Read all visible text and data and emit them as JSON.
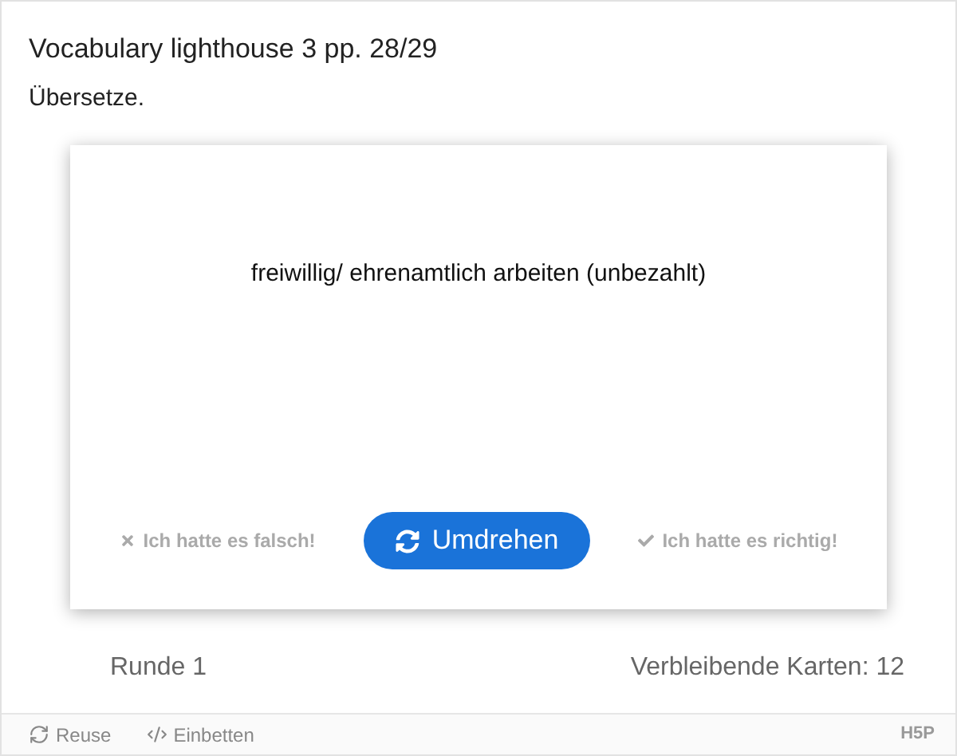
{
  "title": "Vocabulary lighthouse 3 pp. 28/29",
  "instruction": "Übersetze.",
  "card": {
    "text": "freiwillig/ ehrenamtlich arbeiten (unbezahlt)"
  },
  "actions": [
    {
      "kind": "wrong",
      "label": "Ich hatte es falsch!",
      "disabled": true
    },
    {
      "kind": "flip",
      "label": "Umdrehen",
      "disabled": false
    },
    {
      "kind": "right",
      "label": "Ich hatte es richtig!",
      "disabled": true
    }
  ],
  "progress": {
    "round": "Runde 1",
    "remaining": "Verbleibende Karten: 12"
  },
  "footer": {
    "links": [
      {
        "kind": "reuse",
        "label": "Reuse"
      },
      {
        "kind": "embed",
        "label": "Einbetten"
      }
    ],
    "logo": "H5P"
  }
}
